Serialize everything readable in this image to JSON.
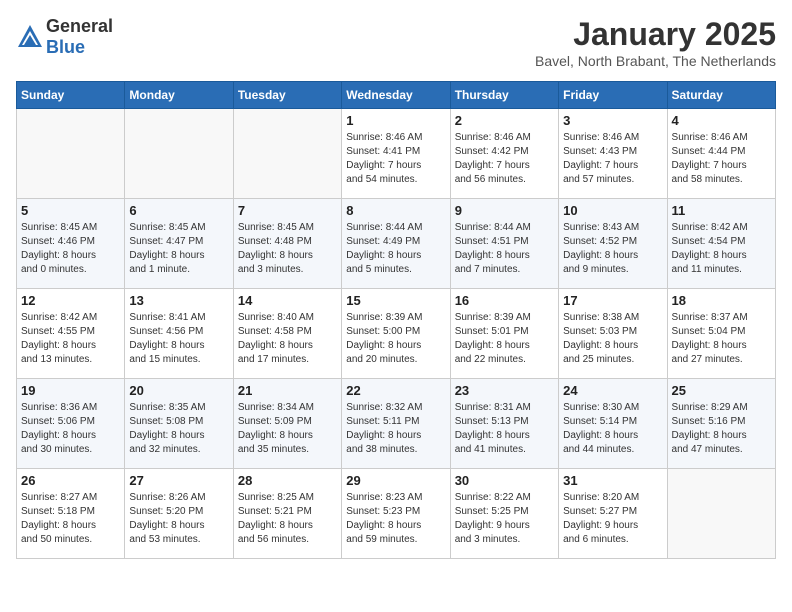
{
  "header": {
    "logo_general": "General",
    "logo_blue": "Blue",
    "month": "January 2025",
    "location": "Bavel, North Brabant, The Netherlands"
  },
  "weekdays": [
    "Sunday",
    "Monday",
    "Tuesday",
    "Wednesday",
    "Thursday",
    "Friday",
    "Saturday"
  ],
  "weeks": [
    [
      {
        "day": "",
        "info": ""
      },
      {
        "day": "",
        "info": ""
      },
      {
        "day": "",
        "info": ""
      },
      {
        "day": "1",
        "info": "Sunrise: 8:46 AM\nSunset: 4:41 PM\nDaylight: 7 hours\nand 54 minutes."
      },
      {
        "day": "2",
        "info": "Sunrise: 8:46 AM\nSunset: 4:42 PM\nDaylight: 7 hours\nand 56 minutes."
      },
      {
        "day": "3",
        "info": "Sunrise: 8:46 AM\nSunset: 4:43 PM\nDaylight: 7 hours\nand 57 minutes."
      },
      {
        "day": "4",
        "info": "Sunrise: 8:46 AM\nSunset: 4:44 PM\nDaylight: 7 hours\nand 58 minutes."
      }
    ],
    [
      {
        "day": "5",
        "info": "Sunrise: 8:45 AM\nSunset: 4:46 PM\nDaylight: 8 hours\nand 0 minutes."
      },
      {
        "day": "6",
        "info": "Sunrise: 8:45 AM\nSunset: 4:47 PM\nDaylight: 8 hours\nand 1 minute."
      },
      {
        "day": "7",
        "info": "Sunrise: 8:45 AM\nSunset: 4:48 PM\nDaylight: 8 hours\nand 3 minutes."
      },
      {
        "day": "8",
        "info": "Sunrise: 8:44 AM\nSunset: 4:49 PM\nDaylight: 8 hours\nand 5 minutes."
      },
      {
        "day": "9",
        "info": "Sunrise: 8:44 AM\nSunset: 4:51 PM\nDaylight: 8 hours\nand 7 minutes."
      },
      {
        "day": "10",
        "info": "Sunrise: 8:43 AM\nSunset: 4:52 PM\nDaylight: 8 hours\nand 9 minutes."
      },
      {
        "day": "11",
        "info": "Sunrise: 8:42 AM\nSunset: 4:54 PM\nDaylight: 8 hours\nand 11 minutes."
      }
    ],
    [
      {
        "day": "12",
        "info": "Sunrise: 8:42 AM\nSunset: 4:55 PM\nDaylight: 8 hours\nand 13 minutes."
      },
      {
        "day": "13",
        "info": "Sunrise: 8:41 AM\nSunset: 4:56 PM\nDaylight: 8 hours\nand 15 minutes."
      },
      {
        "day": "14",
        "info": "Sunrise: 8:40 AM\nSunset: 4:58 PM\nDaylight: 8 hours\nand 17 minutes."
      },
      {
        "day": "15",
        "info": "Sunrise: 8:39 AM\nSunset: 5:00 PM\nDaylight: 8 hours\nand 20 minutes."
      },
      {
        "day": "16",
        "info": "Sunrise: 8:39 AM\nSunset: 5:01 PM\nDaylight: 8 hours\nand 22 minutes."
      },
      {
        "day": "17",
        "info": "Sunrise: 8:38 AM\nSunset: 5:03 PM\nDaylight: 8 hours\nand 25 minutes."
      },
      {
        "day": "18",
        "info": "Sunrise: 8:37 AM\nSunset: 5:04 PM\nDaylight: 8 hours\nand 27 minutes."
      }
    ],
    [
      {
        "day": "19",
        "info": "Sunrise: 8:36 AM\nSunset: 5:06 PM\nDaylight: 8 hours\nand 30 minutes."
      },
      {
        "day": "20",
        "info": "Sunrise: 8:35 AM\nSunset: 5:08 PM\nDaylight: 8 hours\nand 32 minutes."
      },
      {
        "day": "21",
        "info": "Sunrise: 8:34 AM\nSunset: 5:09 PM\nDaylight: 8 hours\nand 35 minutes."
      },
      {
        "day": "22",
        "info": "Sunrise: 8:32 AM\nSunset: 5:11 PM\nDaylight: 8 hours\nand 38 minutes."
      },
      {
        "day": "23",
        "info": "Sunrise: 8:31 AM\nSunset: 5:13 PM\nDaylight: 8 hours\nand 41 minutes."
      },
      {
        "day": "24",
        "info": "Sunrise: 8:30 AM\nSunset: 5:14 PM\nDaylight: 8 hours\nand 44 minutes."
      },
      {
        "day": "25",
        "info": "Sunrise: 8:29 AM\nSunset: 5:16 PM\nDaylight: 8 hours\nand 47 minutes."
      }
    ],
    [
      {
        "day": "26",
        "info": "Sunrise: 8:27 AM\nSunset: 5:18 PM\nDaylight: 8 hours\nand 50 minutes."
      },
      {
        "day": "27",
        "info": "Sunrise: 8:26 AM\nSunset: 5:20 PM\nDaylight: 8 hours\nand 53 minutes."
      },
      {
        "day": "28",
        "info": "Sunrise: 8:25 AM\nSunset: 5:21 PM\nDaylight: 8 hours\nand 56 minutes."
      },
      {
        "day": "29",
        "info": "Sunrise: 8:23 AM\nSunset: 5:23 PM\nDaylight: 8 hours\nand 59 minutes."
      },
      {
        "day": "30",
        "info": "Sunrise: 8:22 AM\nSunset: 5:25 PM\nDaylight: 9 hours\nand 3 minutes."
      },
      {
        "day": "31",
        "info": "Sunrise: 8:20 AM\nSunset: 5:27 PM\nDaylight: 9 hours\nand 6 minutes."
      },
      {
        "day": "",
        "info": ""
      }
    ]
  ]
}
